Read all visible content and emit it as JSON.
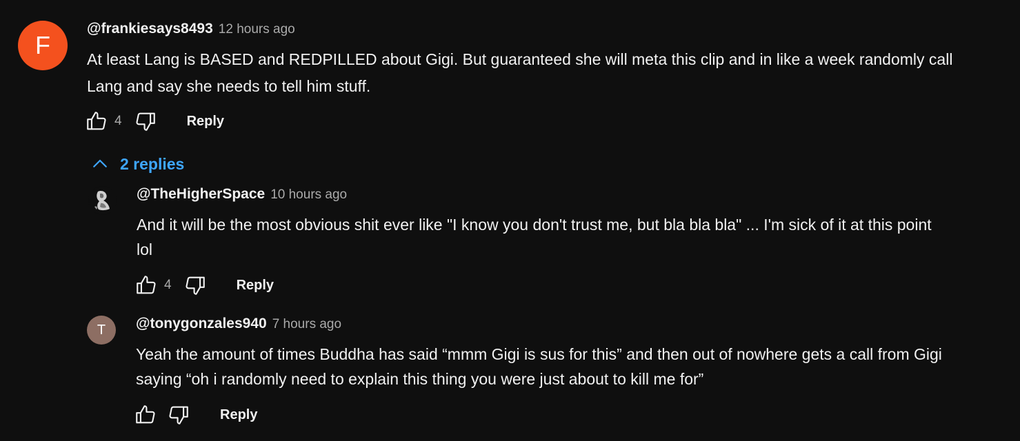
{
  "comments": [
    {
      "handle": "@frankiesays8493",
      "time": "12 hours ago",
      "avatar_letter": "F",
      "avatar_color": "#f4511e",
      "text_line1": "At least Lang is BASED and REDPILLED about Gigi.   But guaranteed she will meta this clip and in like a week randomly call",
      "text_line2": "Lang and say she needs to tell him stuff.",
      "like_count": "4",
      "reply_label": "Reply"
    }
  ],
  "replies_toggle": {
    "label": "2 replies",
    "icon": "chevron-up-icon",
    "color": "#3ea6ff"
  },
  "replies": [
    {
      "handle": "@TheHigherSpace",
      "time": "10 hours ago",
      "avatar": "profile-image",
      "text_line1": "And it will be the most obvious shit ever like \"I know you don't trust me, but bla bla bla\" ... I'm sick of it at this point",
      "text_line2": "lol",
      "like_count": "4",
      "reply_label": "Reply"
    },
    {
      "handle": "@tonygonzales940",
      "time": "7 hours ago",
      "avatar_letter": "T",
      "avatar_color": "#8d6e63",
      "text_line1": "Yeah the amount of times Buddha has said “mmm Gigi is sus for this” and then out of nowhere gets a call from Gigi",
      "text_line2": "saying “oh i randomly need to explain this thing you were just about to kill me for”",
      "like_count": "",
      "reply_label": "Reply"
    }
  ],
  "icons": {
    "like": "thumbs-up-icon",
    "dislike": "thumbs-down-icon"
  }
}
